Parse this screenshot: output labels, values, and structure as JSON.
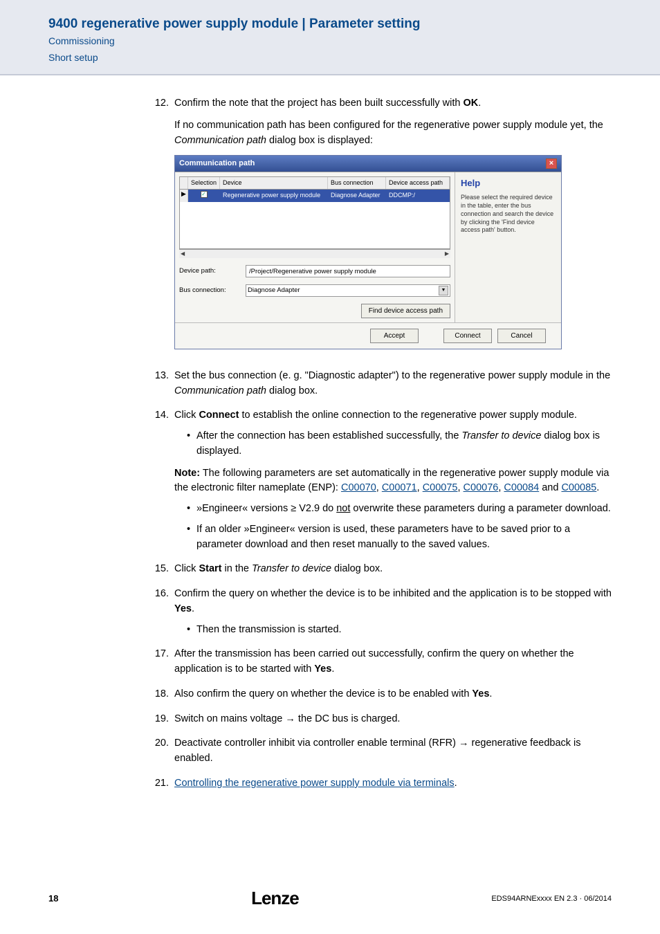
{
  "header": {
    "title": "9400 regenerative power supply module | Parameter setting",
    "sub1": "Commissioning",
    "sub2": "Short setup"
  },
  "steps": {
    "s12": {
      "num": "12.",
      "t1a": "Confirm the note that the project has been built successfully with ",
      "t1b": "OK",
      "t1c": ".",
      "t2a": "If no communication path has been configured for the regenerative power supply module yet, the ",
      "t2b": "Communication path",
      "t2c": " dialog box is displayed:"
    },
    "s13": {
      "num": "13.",
      "t1a": "Set the bus connection (e. g. \"Diagnostic adapter\") to the regenerative power supply module in the ",
      "t1b": "Communication path",
      "t1c": " dialog box."
    },
    "s14": {
      "num": "14.",
      "t1a": "Click ",
      "t1b": "Connect",
      "t1c": " to establish the online connection to the regenerative power supply module.",
      "b1a": "After the connection has been established successfully, the ",
      "b1b": "Transfer to device",
      "b1c": " dialog box is displayed.",
      "n1a": "Note:",
      "n1b": " The following parameters are set automatically in the regenerative power supply module via the electronic filter nameplate (ENP): ",
      "lk1": "C00070",
      "lc1": ", ",
      "lk2": "C00071",
      "lc2": ", ",
      "lk3": "C00075",
      "lc3": ", ",
      "lk4": "C00076",
      "lc4": ", ",
      "lk5": "C00084",
      "lc5": " and ",
      "lk6": "C00085",
      "lc6": ".",
      "b2a": "»Engineer« versions ≥ V2.9 do ",
      "b2b": "not",
      "b2c": " overwrite these parameters during a parameter download.",
      "b3": "If an older »Engineer« version is used, these parameters have to be saved prior to a parameter download and then reset manually to the saved values."
    },
    "s15": {
      "num": "15.",
      "t1a": "Click ",
      "t1b": "Start",
      "t1c": " in the ",
      "t1d": "Transfer to device",
      "t1e": " dialog box."
    },
    "s16": {
      "num": "16.",
      "t1a": "Confirm the query on whether the device is to be inhibited and the application is to be stopped with ",
      "t1b": "Yes",
      "t1c": ".",
      "b1": "Then the transmission is started."
    },
    "s17": {
      "num": "17.",
      "t1a": "After the transmission has been carried out successfully, confirm the query on whether the application is to be started with ",
      "t1b": "Yes",
      "t1c": "."
    },
    "s18": {
      "num": "18.",
      "t1a": "Also confirm the query on whether the device is to be enabled with ",
      "t1b": "Yes",
      "t1c": "."
    },
    "s19": {
      "num": "19.",
      "t1": "Switch on mains voltage → the DC bus is charged."
    },
    "s20": {
      "num": "20.",
      "t1": "Deactivate controller inhibit via controller enable terminal (RFR) → regenerative feedback is enabled."
    },
    "s21": {
      "num": "21.",
      "lk": "Controlling the regenerative power supply module via terminals",
      "t2": "."
    }
  },
  "dialog": {
    "title": "Communication path",
    "cols": {
      "c0": "",
      "c1": "Selection",
      "c2": "Device",
      "c3": "Bus connection",
      "c4": "Device access path"
    },
    "row": {
      "check": "✓",
      "device": "Regenerative power supply module",
      "bus": "Diagnose Adapter",
      "path": "DDCMP:/"
    },
    "devicePathLabel": "Device path:",
    "devicePathValue": "/Project/Regenerative power supply module",
    "busConnLabel": "Bus connection:",
    "busConnValue": "Diagnose Adapter",
    "findBtn": "Find device access path",
    "acceptBtn": "Accept",
    "connectBtn": "Connect",
    "cancelBtn": "Cancel",
    "help": {
      "title": "Help",
      "text": "Please select the required device in the table, enter the bus connection and search the device by clicking the 'Find device access path' button."
    }
  },
  "footer": {
    "page": "18",
    "logo": "Lenze",
    "doccode": "EDS94ARNExxxx EN 2.3 · 06/2014"
  }
}
